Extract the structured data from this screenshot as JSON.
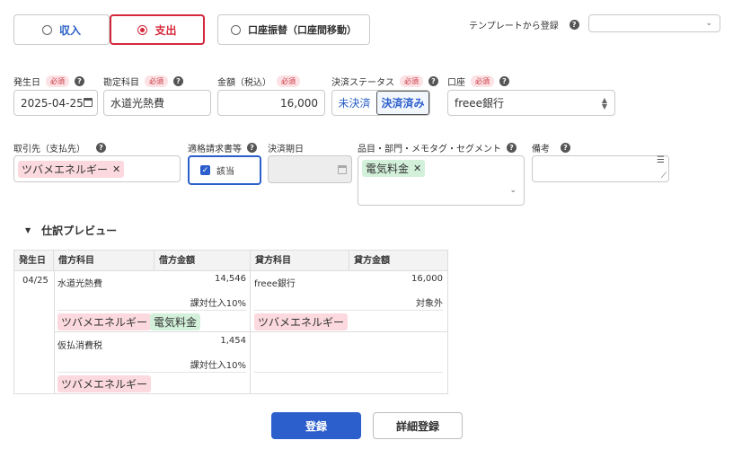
{
  "type_toggle": {
    "income": "収入",
    "expense": "支出",
    "transfer": "口座振替（口座間移動）"
  },
  "template": {
    "label": "テンプレートから登録",
    "value": ""
  },
  "fields": {
    "issue_date": {
      "label": "発生日",
      "required": "必須",
      "value": "2025-04-25"
    },
    "account_item": {
      "label": "勘定科目",
      "required": "必須",
      "value": "水道光熱費"
    },
    "amount": {
      "label": "金額（税込）",
      "required": "必須",
      "value": "16,000"
    },
    "settlement_status": {
      "label": "決済ステータス",
      "required": "必須",
      "options": [
        "未決済",
        "決済済み"
      ],
      "selected": "決済済み"
    },
    "wallet": {
      "label": "口座",
      "required": "必須",
      "value": "freee銀行"
    },
    "partner": {
      "label": "取引先（支払先）",
      "tag": "ツバメエネルギー"
    },
    "qualified_invoice": {
      "label": "適格請求書等",
      "checkbox_label": "該当"
    },
    "due_date": {
      "label": "決済期日",
      "value": ""
    },
    "segments": {
      "label": "品目・部門・メモタグ・セグメント",
      "tag": "電気料金"
    },
    "memo": {
      "label": "備考",
      "value": ""
    }
  },
  "preview": {
    "title": "仕訳プレビュー",
    "headers": [
      "発生日",
      "借方科目",
      "借方金額",
      "貸方科目",
      "貸方金額"
    ],
    "date": "04/25",
    "row1": {
      "debit_account": "水道光熱費",
      "debit_amount": "14,546",
      "debit_tax": "課対仕入10%",
      "credit_account": "freee銀行",
      "credit_amount": "16,000",
      "credit_tax": "対象外",
      "debit_tags": [
        "ツバメエネルギー",
        "電気料金"
      ],
      "credit_tags": [
        "ツバメエネルギー"
      ]
    },
    "row2": {
      "debit_account": "仮払消費税",
      "debit_amount": "1,454",
      "debit_tax": "課対仕入10%",
      "debit_tags": [
        "ツバメエネルギー"
      ]
    }
  },
  "buttons": {
    "register": "登録",
    "detail_register": "詳細登録"
  },
  "colors": {
    "accent_red": "#d4283b",
    "primary_blue": "#2d5fcc",
    "income_blue": "#2a5fc4"
  }
}
